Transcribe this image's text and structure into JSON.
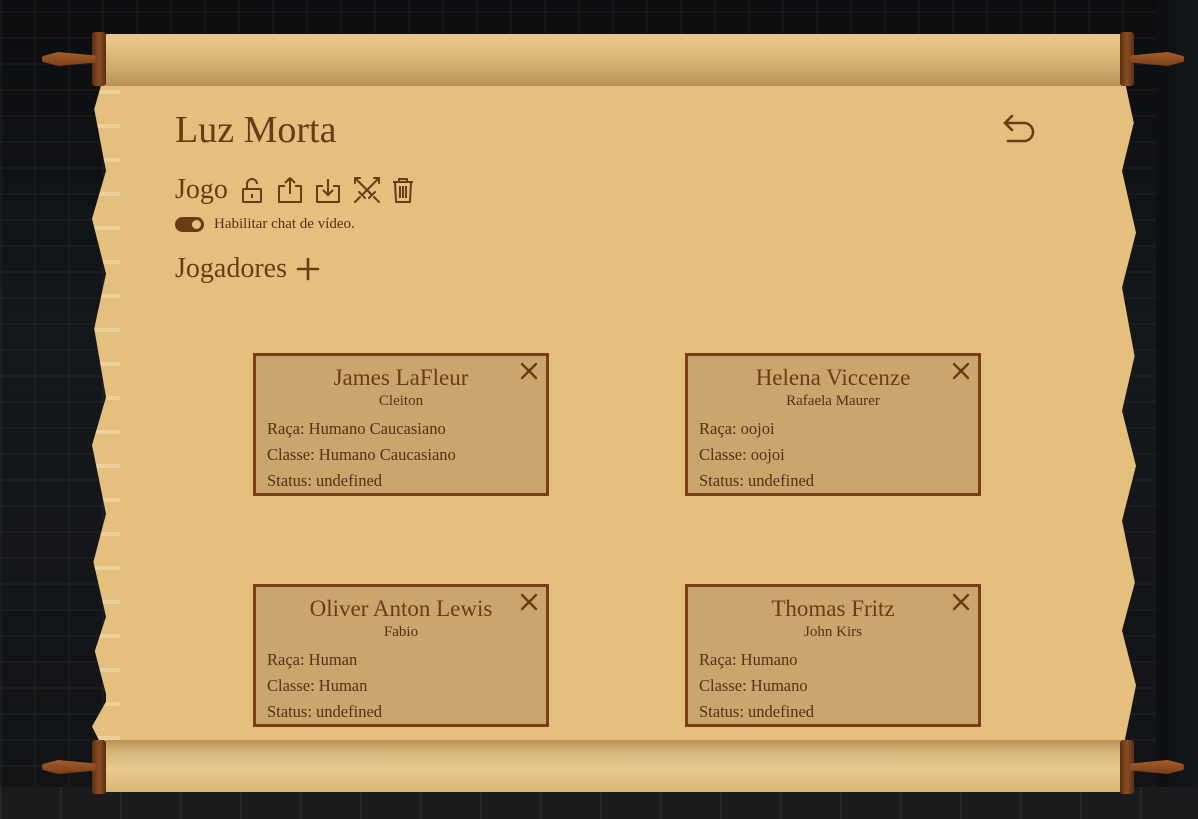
{
  "campaign": {
    "title": "Luz Morta"
  },
  "game_section": {
    "label": "Jogo",
    "tools": [
      "unlock-icon",
      "export-icon",
      "import-icon",
      "crossed-swords-icon",
      "trash-icon"
    ]
  },
  "video_chat": {
    "label": "Habilitar chat de vídeo.",
    "enabled": true
  },
  "players_section": {
    "label": "Jogadores"
  },
  "labels": {
    "race": "Raça: ",
    "class": "Classe: ",
    "status": "Status: "
  },
  "players": [
    {
      "character": "James LaFleur",
      "player": "Cleiton",
      "race": "Raça: Humano Caucasiano",
      "class": "Classe: Humano Caucasiano",
      "status": "Status: undefined"
    },
    {
      "character": "Helena Viccenze",
      "player": "Rafaela Maurer",
      "race": "Raça: oojoi",
      "class": "Classe: oojoi",
      "status": "Status: undefined"
    },
    {
      "character": "Oliver Anton Lewis",
      "player": "Fabio",
      "race": "Raça: Human",
      "class": "Classe: Human",
      "status": "Status: undefined"
    },
    {
      "character": "Thomas Fritz",
      "player": "John Kirs",
      "race": "Raça: Humano",
      "class": "Classe: Humano",
      "status": "Status: undefined"
    }
  ],
  "colors": {
    "ink": "#6b3a16",
    "paper": "#e4bf7d",
    "card": "#caa66e",
    "border": "#7a3d17"
  }
}
